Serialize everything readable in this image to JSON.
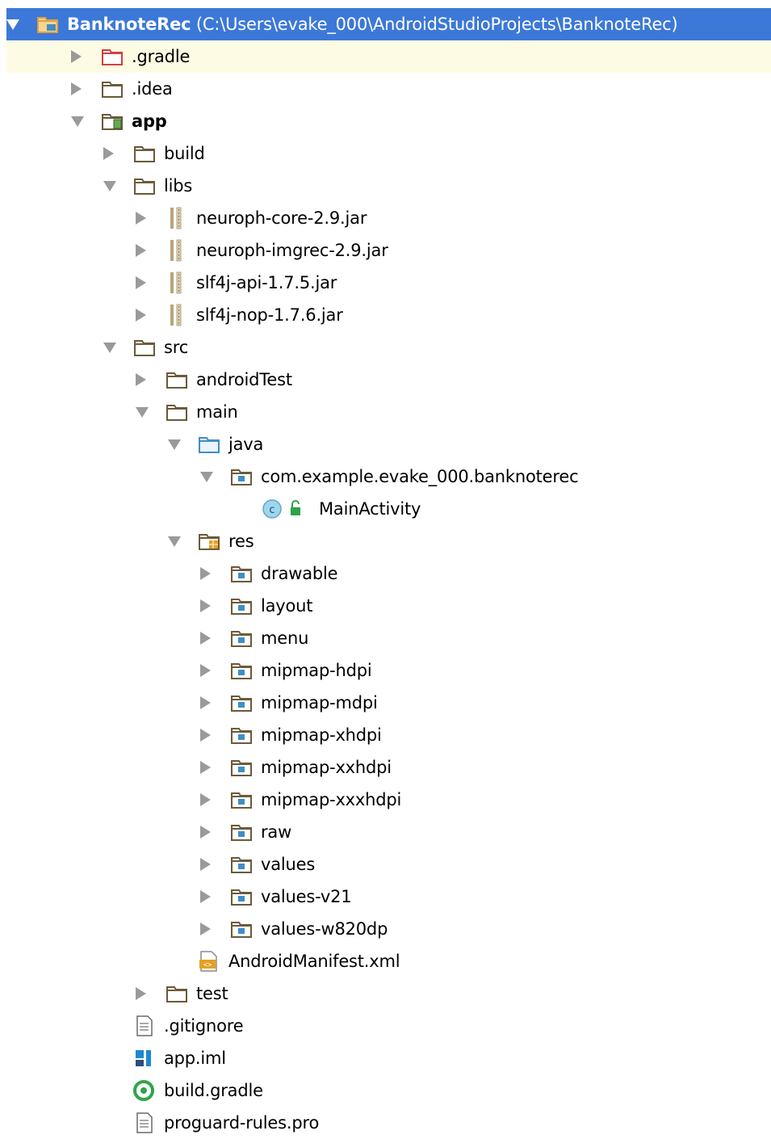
{
  "project": {
    "name": "BanknoteRec",
    "path": "(C:\\Users\\evake_000\\AndroidStudioProjects\\BanknoteRec)"
  },
  "colors": {
    "selection": "#3c78d8",
    "hover_row": "#fdfbe3",
    "folder_outline": "#6b5a3a",
    "folder_fill": "#f3e4c2",
    "source_folder_outline": "#3e8ec8",
    "resource_badge": "#e6a020",
    "jar_stripe": "#b8a47a",
    "class_badge": "#9fd6ee",
    "gradle_green": "#2ea54a",
    "module_blue": "#1e88d0",
    "arrow": "#9a9a9a"
  },
  "tree": [
    {
      "label": "BanknoteRec",
      "depth": 0,
      "arrow": "open",
      "icon": "project-folder-icon",
      "selected": true
    },
    {
      "label": ".gradle",
      "depth": 1,
      "arrow": "closed",
      "icon": "excluded-folder-icon",
      "hover": true
    },
    {
      "label": ".idea",
      "depth": 1,
      "arrow": "closed",
      "icon": "folder-icon"
    },
    {
      "label": "app",
      "depth": 1,
      "arrow": "open",
      "icon": "module-folder-icon",
      "bold": true
    },
    {
      "label": "build",
      "depth": 2,
      "arrow": "closed",
      "icon": "folder-icon"
    },
    {
      "label": "libs",
      "depth": 2,
      "arrow": "open",
      "icon": "folder-icon"
    },
    {
      "label": "neuroph-core-2.9.jar",
      "depth": 3,
      "arrow": "closed",
      "icon": "jar-icon"
    },
    {
      "label": "neuroph-imgrec-2.9.jar",
      "depth": 3,
      "arrow": "closed",
      "icon": "jar-icon"
    },
    {
      "label": "slf4j-api-1.7.5.jar",
      "depth": 3,
      "arrow": "closed",
      "icon": "jar-icon"
    },
    {
      "label": "slf4j-nop-1.7.6.jar",
      "depth": 3,
      "arrow": "closed",
      "icon": "jar-icon"
    },
    {
      "label": "src",
      "depth": 2,
      "arrow": "open",
      "icon": "folder-icon"
    },
    {
      "label": "androidTest",
      "depth": 3,
      "arrow": "closed",
      "icon": "folder-icon"
    },
    {
      "label": "main",
      "depth": 3,
      "arrow": "open",
      "icon": "folder-icon"
    },
    {
      "label": "java",
      "depth": 4,
      "arrow": "open",
      "icon": "source-folder-icon"
    },
    {
      "label": "com.example.evake_000.banknoterec",
      "depth": 5,
      "arrow": "open",
      "icon": "package-icon"
    },
    {
      "label": "MainActivity",
      "depth": 6,
      "arrow": "none",
      "icon": "class-icon"
    },
    {
      "label": "res",
      "depth": 4,
      "arrow": "open",
      "icon": "resource-folder-icon"
    },
    {
      "label": "drawable",
      "depth": 5,
      "arrow": "closed",
      "icon": "package-icon"
    },
    {
      "label": "layout",
      "depth": 5,
      "arrow": "closed",
      "icon": "package-icon"
    },
    {
      "label": "menu",
      "depth": 5,
      "arrow": "closed",
      "icon": "package-icon"
    },
    {
      "label": "mipmap-hdpi",
      "depth": 5,
      "arrow": "closed",
      "icon": "package-icon"
    },
    {
      "label": "mipmap-mdpi",
      "depth": 5,
      "arrow": "closed",
      "icon": "package-icon"
    },
    {
      "label": "mipmap-xhdpi",
      "depth": 5,
      "arrow": "closed",
      "icon": "package-icon"
    },
    {
      "label": "mipmap-xxhdpi",
      "depth": 5,
      "arrow": "closed",
      "icon": "package-icon"
    },
    {
      "label": "mipmap-xxxhdpi",
      "depth": 5,
      "arrow": "closed",
      "icon": "package-icon"
    },
    {
      "label": "raw",
      "depth": 5,
      "arrow": "closed",
      "icon": "package-icon"
    },
    {
      "label": "values",
      "depth": 5,
      "arrow": "closed",
      "icon": "package-icon"
    },
    {
      "label": "values-v21",
      "depth": 5,
      "arrow": "closed",
      "icon": "package-icon"
    },
    {
      "label": "values-w820dp",
      "depth": 5,
      "arrow": "closed",
      "icon": "package-icon"
    },
    {
      "label": "AndroidManifest.xml",
      "depth": 4,
      "arrow": "none",
      "icon": "manifest-xml-icon"
    },
    {
      "label": "test",
      "depth": 3,
      "arrow": "closed",
      "icon": "folder-icon"
    },
    {
      "label": ".gitignore",
      "depth": 2,
      "arrow": "none",
      "icon": "text-file-icon"
    },
    {
      "label": "app.iml",
      "depth": 2,
      "arrow": "none",
      "icon": "iml-module-icon"
    },
    {
      "label": "build.gradle",
      "depth": 2,
      "arrow": "none",
      "icon": "gradle-icon"
    },
    {
      "label": "proguard-rules.pro",
      "depth": 2,
      "arrow": "none",
      "icon": "text-file-icon"
    }
  ]
}
